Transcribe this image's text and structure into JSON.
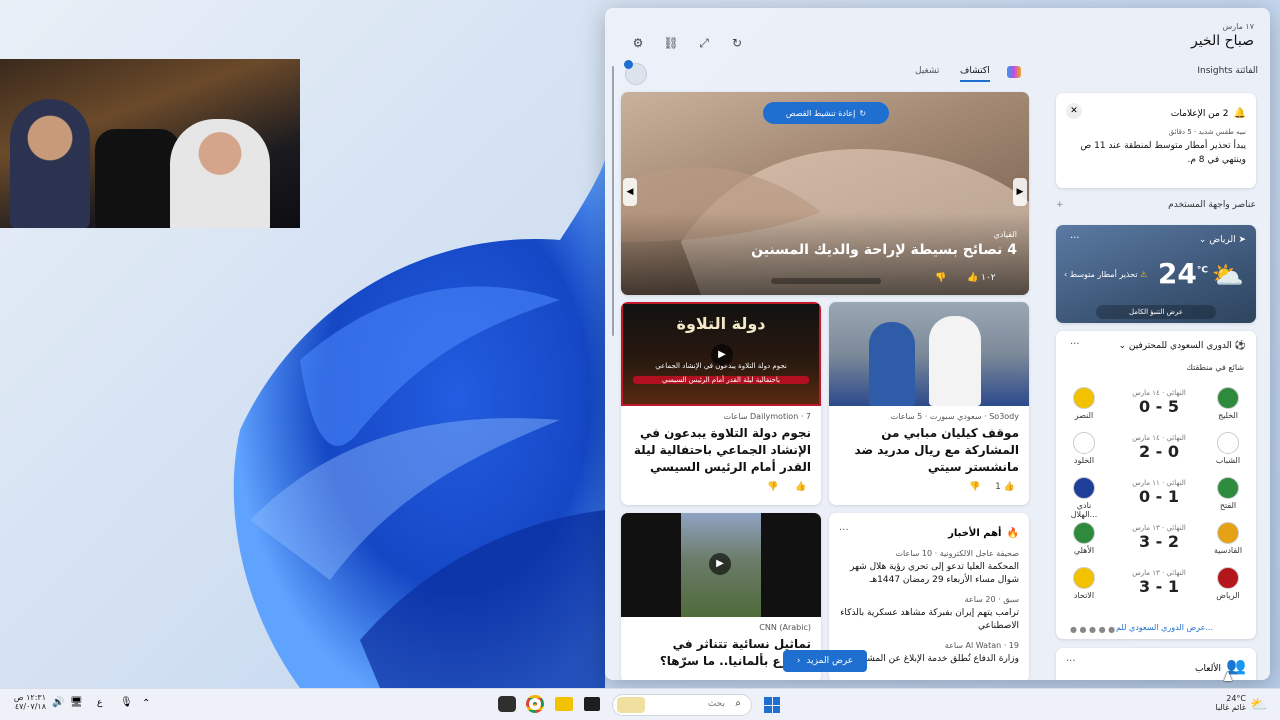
{
  "panel": {
    "date": "١٧ مارس",
    "greeting": "صباح الخير",
    "insights": "Insights الفائتة",
    "tabs": [
      "اكتشاف",
      "تشغيل"
    ],
    "ui_elements": "عناصر واجهة المستخدم"
  },
  "alerts": {
    "title": "2 من الإعلامات",
    "source": "نبيه طقس شديد · 5 دقائق",
    "body": "يبدأ تحذير أمطار متوسط لمنطقة عند 11 ص وينتهي في 8 م."
  },
  "weather": {
    "city": "الرياض",
    "temp": "24",
    "unit": "°C",
    "alert": "تحذير أمطار متوسط",
    "link": "عرض التنبؤ الكامل"
  },
  "league": {
    "title": "الدوري السعودي للمحترفين",
    "trend": "شائع في منطقتك",
    "more": "عرض الدوري السعودي للم...",
    "matches": [
      {
        "home": "الخليج",
        "away": "النصر",
        "score": "0 - 5",
        "meta": "النهائي · ١٤ مارس",
        "home_color": "#2e8b3d",
        "away_color": "#f2c200"
      },
      {
        "home": "الشباب",
        "away": "الخلود",
        "score": "2 - 0",
        "meta": "النهائي · ١٤ مارس",
        "home_color": "#ffffff",
        "away_color": "#ffffff"
      },
      {
        "home": "الفتح",
        "away": "نادي الهلال...",
        "score": "0 - 1",
        "meta": "النهائي · ١١ مارس",
        "home_color": "#2e8b3d",
        "away_color": "#1d3f9a"
      },
      {
        "home": "القادسية",
        "away": "الأهلي",
        "score": "3 - 2",
        "meta": "النهائي · ١٣ مارس",
        "home_color": "#e5a216",
        "away_color": "#2e8b3d"
      },
      {
        "home": "الرياض",
        "away": "الاتحاد",
        "score": "3 - 1",
        "meta": "النهائي · ١٣ مارس",
        "home_color": "#b4161b",
        "away_color": "#f2c200"
      }
    ]
  },
  "games": {
    "title": "الألعاب"
  },
  "hero": {
    "refresh": "إعادة تنشيط القصص",
    "category": "القيادي",
    "title": "4 نصائح بسيطة لإراحة والديك المسنين",
    "likes": "١٠٢"
  },
  "cards": [
    {
      "source": "So3ody · سعودي سبورت · 5 ساعات",
      "title": "موقف كيليان مبابي من المشاركة مع ريال مدريد ضد مانشستر سيتي",
      "likes": "1"
    },
    {
      "source": "Dailymotion · 7 ساعات",
      "title": "نجوم دولة التلاوة يبدعون في الإنشاد الجماعي باحتفالية ليلة القدر أمام الرئيس السيسي",
      "img_text1": "دولة التلاوة",
      "img_text2": "نجوم دولة التلاوة يبدعون في الإنشاد الجماعي",
      "img_text3": "باحتفالية ليلة القدر أمام الرئيس السيسي"
    }
  ],
  "top_news": {
    "title": "أهم الأخبار",
    "items": [
      {
        "source": "صحيفة عاجل الالكترونية · 10 ساعات",
        "title": "المحكمة العليا تدعو إلى تحري رؤية هلال شهر شوال مساء الأربعاء 29 رمضان 1447هـ"
      },
      {
        "source": "سبق · 20 ساعة",
        "title": "ترامب يتهم إيران بفبركة مشاهد عسكرية بالذكاء الاصطناعي"
      },
      {
        "source": "Al Watan · 19 ساعة",
        "title": "وزارة الدفاع تُطلق خدمة الإبلاغ عن المشتبه"
      }
    ]
  },
  "cnn": {
    "source": "CNN (Arabic)",
    "title": "تماثيل نسائية تتناثر في شوارع بألمانيا.. ما سرّها؟"
  },
  "more_btn": "عرض المزيد",
  "taskbar": {
    "search_placeholder": "بحث",
    "weather_temp": "24°C",
    "weather_desc": "غائم غالبا",
    "time": "١٢:٣١ ص",
    "date": "٤٧/٠٧/١٨",
    "lang": "ع"
  }
}
